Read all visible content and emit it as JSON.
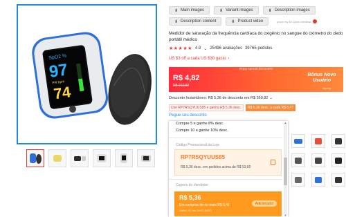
{
  "toolbar": {
    "main_images": "Main images",
    "variant_images": "Variant images",
    "description_images": "Description images",
    "description_content": "Description content",
    "product_video": "Product video",
    "powered_by": "power by Ali Quick Infinitear"
  },
  "product": {
    "title": "Medidor de saturação da frequência cardíaca do oxigênio no sangue do oxímetro do dedo portátil médico",
    "rating": "4.9",
    "stars": "★★★★★",
    "reviews": "25496 avaliações",
    "orders": "39765 pedidos",
    "coupon_line": "US $3 off a cada US $30 gasto"
  },
  "device_screen": {
    "label": "SpO2 %",
    "spo2": "97",
    "pr": "74",
    "pr_label": "PR bpm"
  },
  "price_banner": {
    "tag": "Enjoy special discounts!",
    "price": "R$ 4,82",
    "old_price": "R$ 162,89",
    "bonus": "Bônus Novo Usuário",
    "bonus_sub": "log-ing"
  },
  "discounts": {
    "line": "Desconto Instantâneo: R$ 5,36 de desconto em R$ 369,82",
    "code_tag": "Use RP7RSQYUUS85 e ganha R$ 5,36 desc.",
    "orange_tag": "R$ 5,36 desc. a cada R$ 5,47",
    "link": "Pegue seu desconto"
  },
  "panel": {
    "item1": "Compre 5 e ganhe 8% desc.",
    "item2": "Compre 10 e ganhe 10% desc.",
    "store_label": "Código Promocional da Loja",
    "store_code": "RP7RSQYUUS85",
    "store_desc": "R$ 5,36 desc. em pedidos acima de R$ 53,60",
    "seller_label": "Cupons do Vendedor",
    "seller_amount": "R$ 5,36",
    "seller_desc": "Em compras de ou mais R$ 5,41",
    "seller_valid": "Válido 30 Jan 19:07 (BRT)",
    "claim": "Adicionado!"
  },
  "colors": {
    "accent_red": "#e53935",
    "accent_orange": "#ff9a1f",
    "link_blue": "#1e88e5"
  }
}
